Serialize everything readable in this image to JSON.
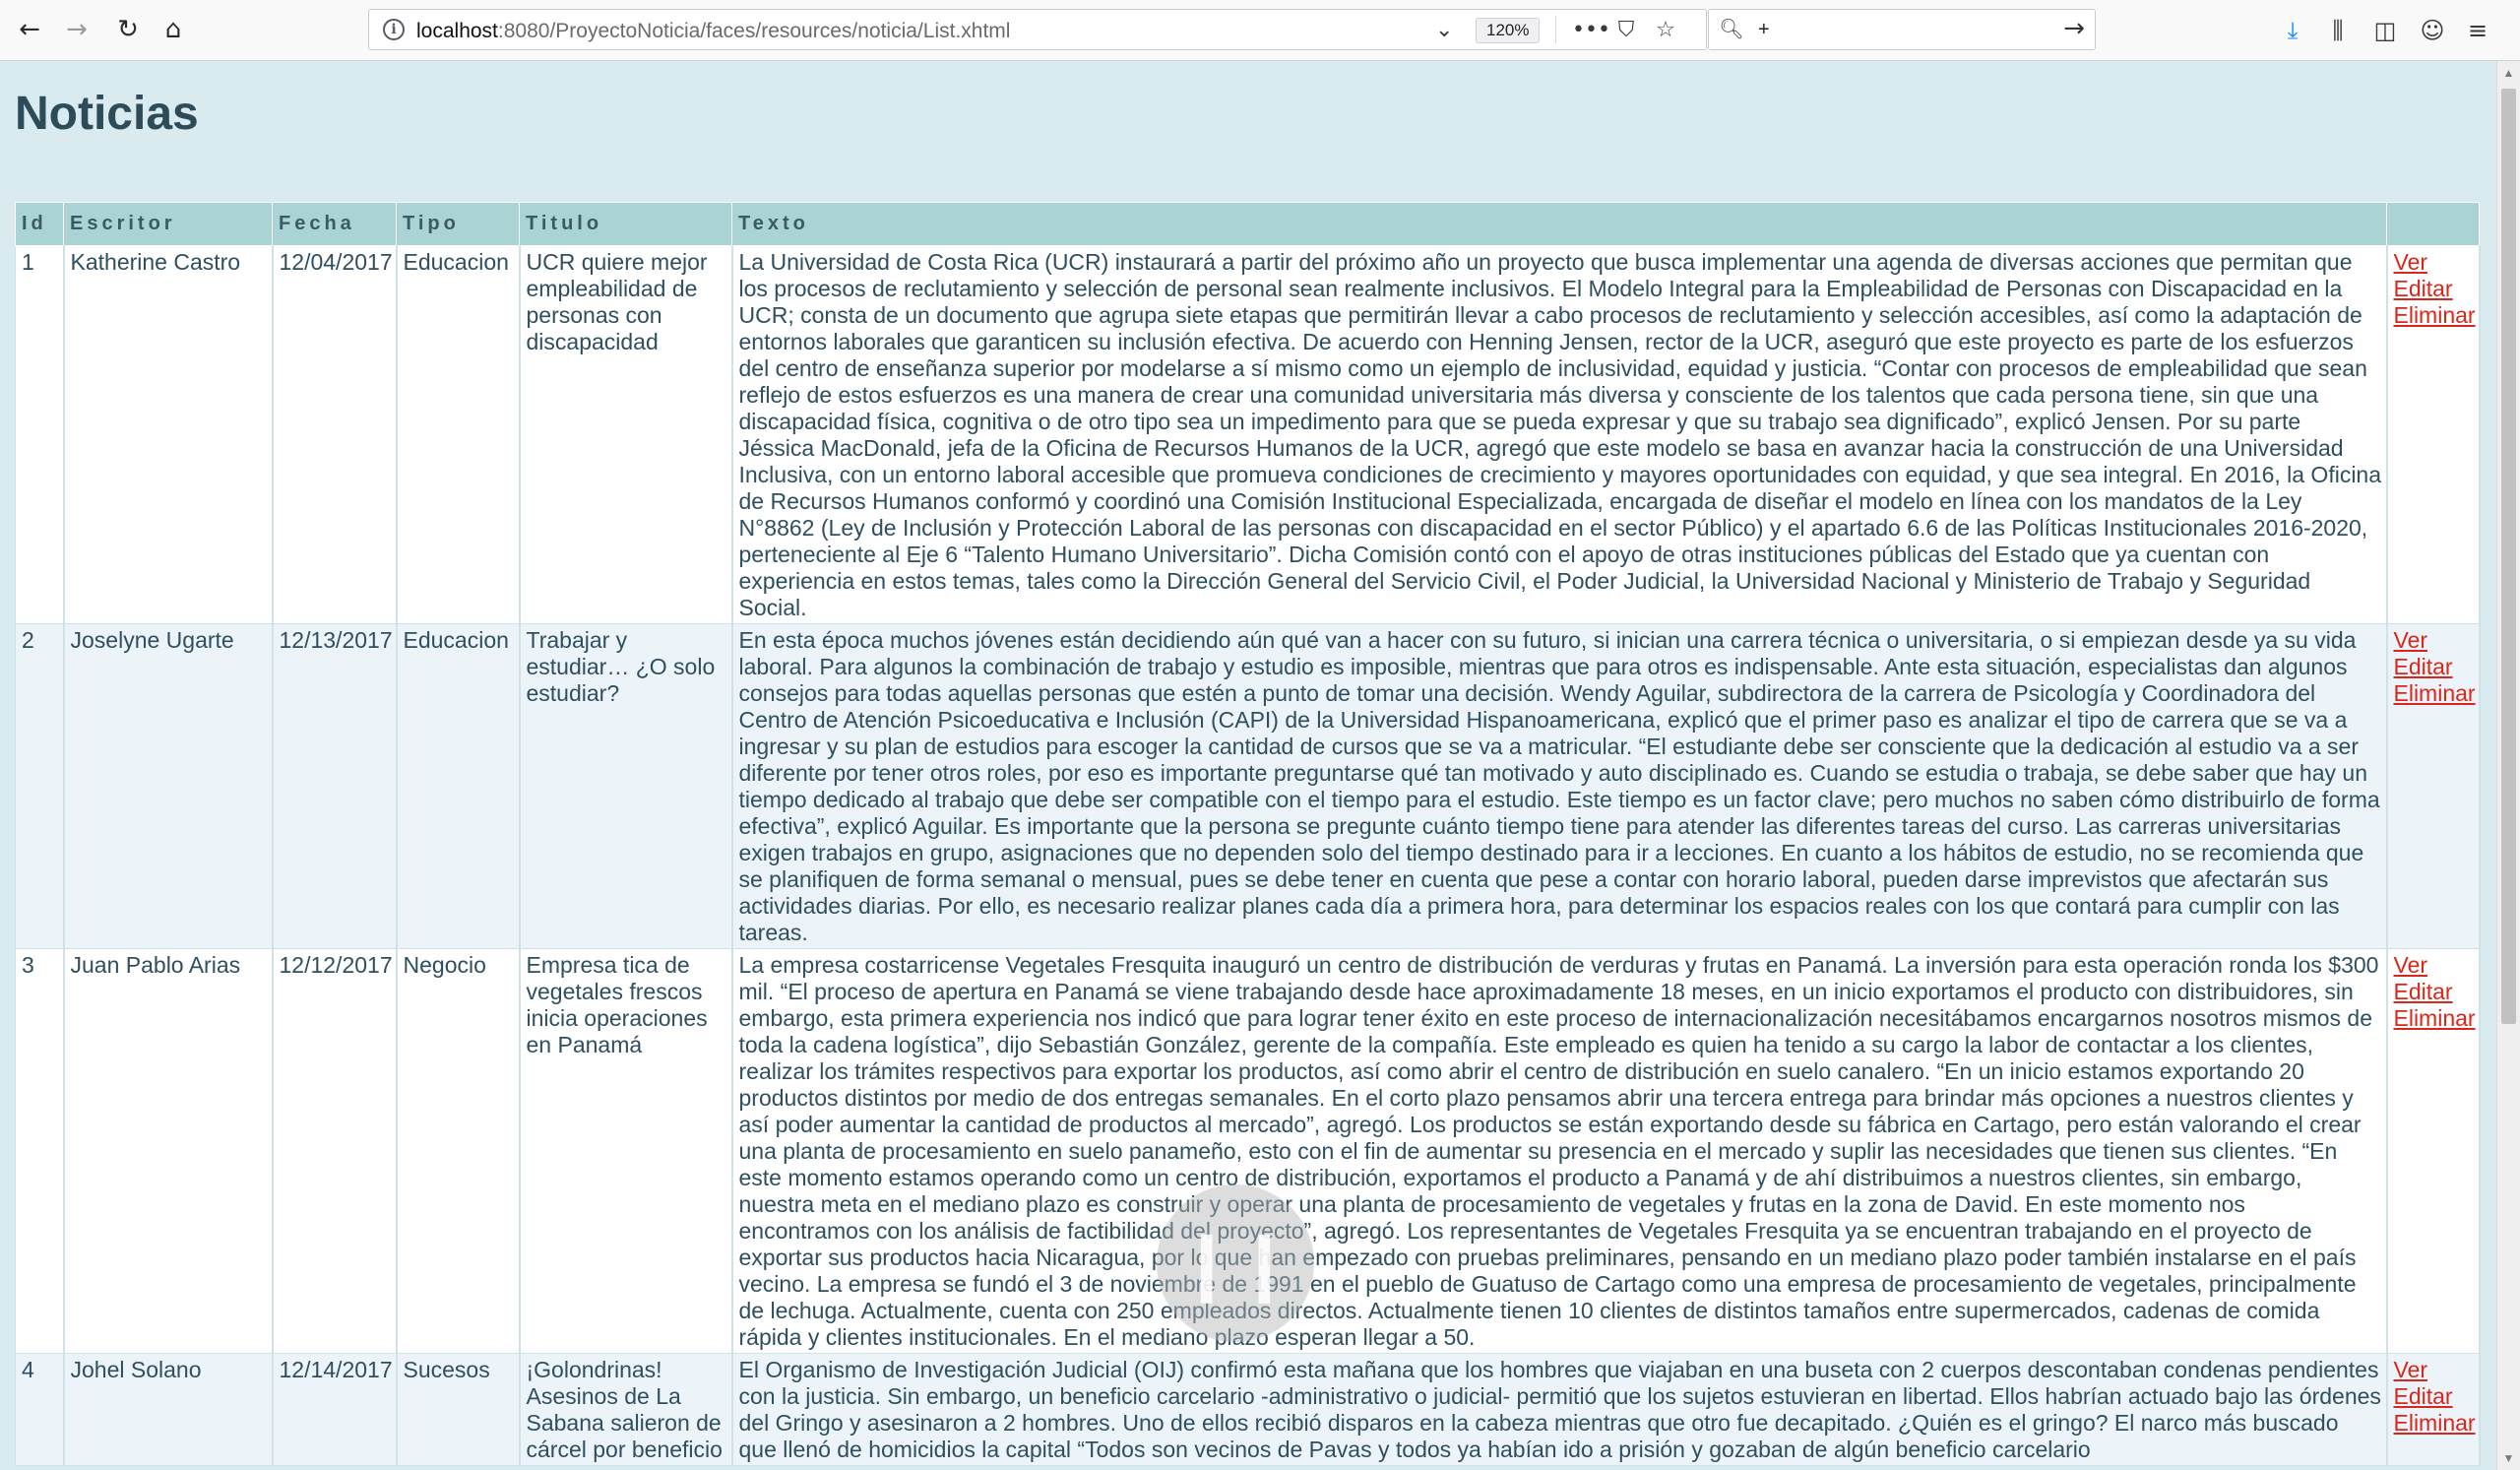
{
  "browser": {
    "url_host": "localhost",
    "url_rest": ":8080/ProyectoNoticia/faces/resources/noticia/List.xhtml",
    "zoom": "120%",
    "search_text": "+"
  },
  "page": {
    "title": "Noticias"
  },
  "table": {
    "headers": {
      "id": "Id",
      "escritor": "Escritor",
      "fecha": "Fecha",
      "tipo": "Tipo",
      "titulo": "Titulo",
      "texto": "Texto",
      "acciones": ""
    },
    "action_labels": {
      "ver": "Ver",
      "editar": "Editar",
      "eliminar": "Eliminar"
    },
    "rows": [
      {
        "id": "1",
        "escritor": "Katherine Castro",
        "fecha": "12/04/2017",
        "tipo": "Educacion",
        "titulo": "UCR quiere mejor empleabilidad de personas con discapacidad",
        "texto": "La Universidad de Costa Rica (UCR) instaurará a partir del próximo año un proyecto que busca implementar una agenda de diversas acciones que permitan que los procesos de reclutamiento y selección de personal sean realmente inclusivos. El Modelo Integral para la Empleabilidad de Personas con Discapacidad en la UCR; consta de un documento que agrupa siete etapas que permitirán llevar a cabo procesos de reclutamiento y selección accesibles, así como la adaptación de entornos laborales que garanticen su inclusión efectiva. De acuerdo con Henning Jensen, rector de la UCR, aseguró que este proyecto es parte de los esfuerzos del centro de enseñanza superior por modelarse a sí mismo como un ejemplo de inclusividad, equidad y justicia. “Contar con procesos de empleabilidad que sean reflejo de estos esfuerzos es una manera de crear una comunidad universitaria más diversa y consciente de los talentos que cada persona tiene, sin que una discapacidad física, cognitiva o de otro tipo sea un impedimento para que se pueda expresar y que su trabajo sea dignificado”, explicó Jensen. Por su parte Jéssica MacDonald, jefa de la Oficina de Recursos Humanos de la UCR, agregó que este modelo se basa en avanzar hacia la construcción de una Universidad Inclusiva, con un entorno laboral accesible que promueva condiciones de crecimiento y mayores oportunidades con equidad, y que sea integral. En 2016, la Oficina de Recursos Humanos conformó y coordinó una Comisión Institucional Especializada, encargada de diseñar el modelo en línea con los mandatos de la Ley N°8862 (Ley de Inclusión y Protección Laboral de las personas con discapacidad en el sector Público) y el apartado 6.6 de las Políticas Institucionales 2016-2020, perteneciente al Eje 6 “Talento Humano Universitario”. Dicha Comisión contó con el apoyo de otras instituciones públicas del Estado que ya cuentan con experiencia en estos temas, tales como la Dirección General del Servicio Civil, el Poder Judicial, la Universidad Nacional y Ministerio de Trabajo y Seguridad Social."
      },
      {
        "id": "2",
        "escritor": "Joselyne Ugarte",
        "fecha": "12/13/2017",
        "tipo": "Educacion",
        "titulo": "Trabajar y estudiar… ¿O solo estudiar?",
        "texto": "En esta época muchos jóvenes están decidiendo aún qué van a hacer con su futuro, si inician una carrera técnica o universitaria, o si empiezan desde ya su vida laboral. Para algunos la combinación de trabajo y estudio es imposible, mientras que para otros es indispensable. Ante esta situación, especialistas dan algunos consejos para todas aquellas personas que estén a punto de tomar una decisión. Wendy Aguilar, subdirectora de la carrera de Psicología y Coordinadora del Centro de Atención Psicoeducativa e Inclusión (CAPI) de la Universidad Hispanoamericana, explicó que el primer paso es analizar el tipo de carrera que se va a ingresar y su plan de estudios para escoger la cantidad de cursos que se va a matricular. “El estudiante debe ser consciente que la dedicación al estudio va a ser diferente por tener otros roles, por eso es importante preguntarse qué tan motivado y auto disciplinado es. Cuando se estudia o trabaja, se debe saber que hay un tiempo dedicado al trabajo que debe ser compatible con el tiempo para el estudio. Este tiempo es un factor clave; pero muchos no saben cómo distribuirlo de forma efectiva”, explicó Aguilar. Es importante que la persona se pregunte cuánto tiempo tiene para atender las diferentes tareas del curso. Las carreras universitarias exigen trabajos en grupo, asignaciones que no dependen solo del tiempo destinado para ir a lecciones. En cuanto a los hábitos de estudio, no se recomienda que se planifiquen de forma semanal o mensual, pues se debe tener en cuenta que pese a contar con horario laboral, pueden darse imprevistos que afectarán sus actividades diarias. Por ello, es necesario realizar planes cada día a primera hora, para determinar los espacios reales con los que contará para cumplir con las tareas."
      },
      {
        "id": "3",
        "escritor": "Juan Pablo Arias",
        "fecha": "12/12/2017",
        "tipo": "Negocio",
        "titulo": "Empresa tica de vegetales frescos inicia operaciones en Panamá",
        "texto": "La empresa costarricense Vegetales Fresquita inauguró un centro de distribución de verduras y frutas en Panamá. La inversión para esta operación ronda los $300 mil. “El proceso de apertura en Panamá se viene trabajando desde hace aproximadamente 18 meses, en un inicio exportamos el producto con distribuidores, sin embargo, esta primera experiencia nos indicó que para lograr tener éxito en este proceso de internacionalización necesitábamos encargarnos nosotros mismos de toda la cadena logística”, dijo Sebastián González, gerente de la compañía. Este empleado es quien ha tenido a su cargo la labor de contactar a los clientes, realizar los trámites respectivos para exportar los productos, así como abrir el centro de distribución en suelo canalero. “En un inicio estamos exportando 20 productos distintos por medio de dos entregas semanales. En el corto plazo pensamos abrir una tercera entrega para brindar más opciones a nuestros clientes y así poder aumentar la cantidad de productos al mercado”, agregó. Los productos se están exportando desde su fábrica en Cartago, pero están valorando el crear una planta de procesamiento en suelo panameño, esto con el fin de aumentar su presencia en el mercado y suplir las necesidades que tienen sus clientes. “En este momento estamos operando como un centro de distribución, exportamos el producto a Panamá y de ahí distribuimos a nuestros clientes, sin embargo, nuestra meta en el mediano plazo es construir y operar una planta de procesamiento de vegetales y frutas en la zona de David. En este momento nos encontramos con los análisis de factibilidad del proyecto”, agregó. Los representantes de Vegetales Fresquita ya se encuentran trabajando en el proyecto de exportar sus productos hacia Nicaragua, por lo que han empezado con pruebas preliminares, pensando en un mediano plazo poder también instalarse en el país vecino. La empresa se fundó el 3 de noviembre de 1991 en el pueblo de Guatuso de Cartago como una empresa de procesamiento de vegetales, principalmente de lechuga. Actualmente, cuenta con 250 empleados directos. Actualmente tienen 10 clientes de distintos tamaños entre supermercados, cadenas de comida rápida y clientes institucionales. En el mediano plazo esperan llegar a 50."
      },
      {
        "id": "4",
        "escritor": "Johel Solano",
        "fecha": "12/14/2017",
        "tipo": "Sucesos",
        "titulo": "¡Golondrinas! Asesinos de La Sabana salieron de cárcel por beneficio",
        "texto": "El Organismo de Investigación Judicial (OIJ) confirmó esta mañana que los hombres que viajaban en una buseta con 2 cuerpos descontaban condenas pendientes con la justicia. Sin embargo, un beneficio carcelario -administrativo o judicial- permitió que los sujetos estuvieran en libertad. Ellos habrían actuado bajo las órdenes del Gringo y asesinaron a 2 hombres. Uno de ellos recibió disparos en la cabeza mientras que otro fue decapitado. ¿Quién es el gringo? El narco más buscado que llenó de homicidios la capital “Todos son vecinos de Pavas y todos ya habían ido a prisión y gozaban de algún beneficio carcelario"
      }
    ]
  }
}
